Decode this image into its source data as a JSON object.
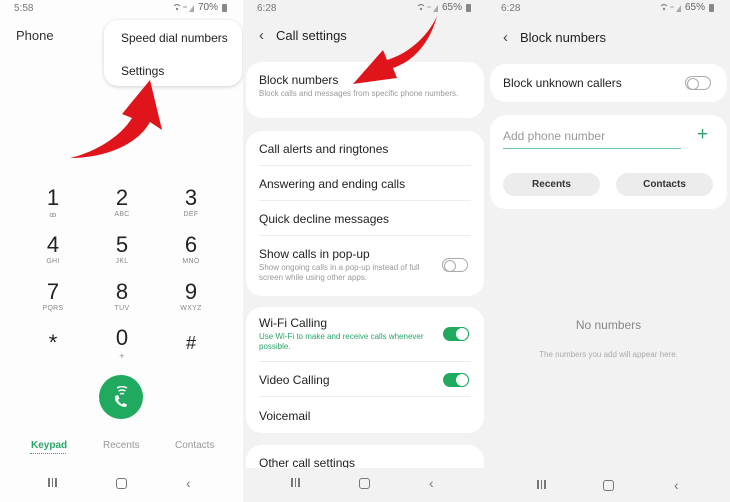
{
  "panel_phone": {
    "status": {
      "time": "5:58",
      "battery": "70%"
    },
    "title": "Phone",
    "menu": {
      "items": [
        "Speed dial numbers",
        "Settings"
      ]
    },
    "keypad": [
      {
        "digit": "1",
        "letters": "voicemail"
      },
      {
        "digit": "2",
        "letters": "ABC"
      },
      {
        "digit": "3",
        "letters": "DEF"
      },
      {
        "digit": "4",
        "letters": "GHI"
      },
      {
        "digit": "5",
        "letters": "JKL"
      },
      {
        "digit": "6",
        "letters": "MNO"
      },
      {
        "digit": "7",
        "letters": "PQRS"
      },
      {
        "digit": "8",
        "letters": "TUV"
      },
      {
        "digit": "9",
        "letters": "WXYZ"
      },
      {
        "digit": "*",
        "letters": ""
      },
      {
        "digit": "0",
        "letters": "+"
      },
      {
        "digit": "#",
        "letters": ""
      }
    ],
    "keypad_voicemail_glyph": "ꝏ",
    "call_button_icon": "wifi-call-icon",
    "tabs": [
      "Keypad",
      "Recents",
      "Contacts"
    ],
    "active_tab": "Keypad"
  },
  "panel_call_settings": {
    "status": {
      "time": "6:28",
      "battery": "65%"
    },
    "title": "Call settings",
    "block_numbers": {
      "title": "Block numbers",
      "subtitle": "Block calls and messages from specific phone numbers."
    },
    "group1": [
      {
        "title": "Call alerts and ringtones"
      },
      {
        "title": "Answering and ending calls"
      },
      {
        "title": "Quick decline messages"
      },
      {
        "title": "Show calls in pop-up",
        "subtitle": "Show ongoing calls in a pop-up instead of full screen while using other apps.",
        "toggle": false
      }
    ],
    "group2": [
      {
        "title": "Wi-Fi Calling",
        "subtitle": "Use Wi-Fi to make and receive calls whenever possible.",
        "toggle": true
      },
      {
        "title": "Video Calling",
        "toggle": true
      },
      {
        "title": "Voicemail"
      }
    ],
    "other": "Other call settings"
  },
  "panel_block_numbers": {
    "status": {
      "time": "6:28",
      "battery": "65%"
    },
    "title": "Block numbers",
    "block_unknown": {
      "label": "Block unknown callers",
      "toggle": false
    },
    "add_phone_placeholder": "Add phone number",
    "buttons": [
      "Recents",
      "Contacts"
    ],
    "empty_title": "No numbers",
    "empty_subtitle": "The numbers you add will appear here."
  },
  "nav": {
    "back_glyph": "‹"
  },
  "colors": {
    "accent_green": "#1faa5f",
    "arrow_red": "#e0151b"
  }
}
